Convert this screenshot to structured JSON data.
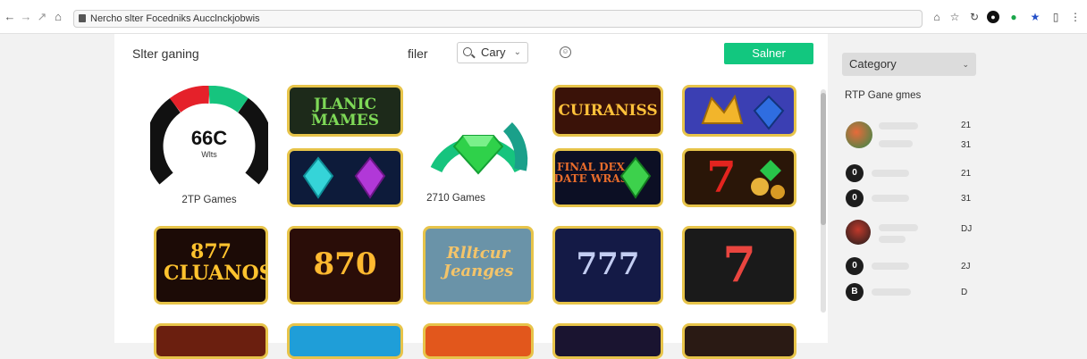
{
  "browser": {
    "url": "Nercho slter Focedniks Aucclnckjobwis",
    "back_icon": "←",
    "forward_icon": "→",
    "forward2_icon": "↗",
    "home_icon": "⌂"
  },
  "header": {
    "site_title": "Slter ganing",
    "filter_label": "filer",
    "city_value": "Cary",
    "submit_label": "Salner"
  },
  "gauges": [
    {
      "center_value": "66C",
      "center_sub": "Wlts",
      "caption": "2TP Games"
    },
    {
      "caption": "2710 Games"
    }
  ],
  "tiles": [
    {
      "text": "JLANIC MAMES"
    },
    {
      "text": ""
    },
    {
      "text": "CUIRANISS"
    },
    {
      "text": ""
    },
    {
      "text": ""
    },
    {
      "text": "FINAL DEX DATE WRAS"
    },
    {
      "text": "7"
    },
    {
      "text": "877 CLUANOS"
    },
    {
      "text": "870"
    },
    {
      "text": "Rlltcur Jeanges"
    },
    {
      "text": "777"
    },
    {
      "text": "7"
    }
  ],
  "sidebar": {
    "category_label": "Category",
    "heading": "RTP Gane gmes",
    "items": [
      {
        "avatar": "",
        "count_a": "21",
        "count_b": "31"
      },
      {
        "avatar": "0",
        "count": "21"
      },
      {
        "avatar": "0",
        "count": "31"
      },
      {
        "avatar": "",
        "count": "DJ"
      },
      {
        "avatar": "0",
        "count": "2J"
      },
      {
        "avatar": "B",
        "count": "D"
      }
    ]
  },
  "colors": {
    "accent": "#12c77f",
    "tile_border": "#e7c44a",
    "gauge_red": "#e5212a",
    "gauge_green": "#16c47e"
  }
}
